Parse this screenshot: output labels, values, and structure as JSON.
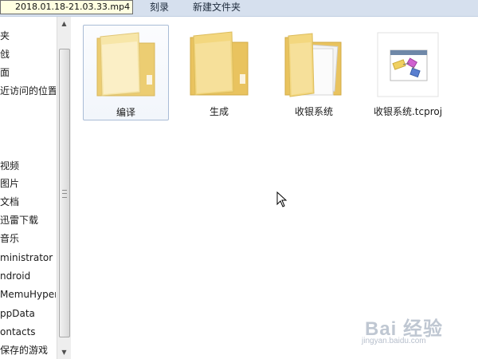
{
  "tooltip": {
    "text": "2018.01.18-21.03.33.mp4"
  },
  "toolbar": {
    "burn_label": "刻录",
    "new_folder_label": "新建文件夹"
  },
  "nav": {
    "items": [
      "夹",
      "戗",
      "面",
      "近访问的位置",
      "视频",
      "图片",
      "文档",
      "迅雷下载",
      "音乐",
      "ministrator",
      "ndroid",
      "MemuHyperv",
      "ppData",
      "ontacts",
      "保存的游戏"
    ]
  },
  "files": [
    {
      "name": "编译",
      "icon": "folder-empty-icon",
      "selected": true
    },
    {
      "name": "生成",
      "icon": "folder-empty-icon",
      "selected": false
    },
    {
      "name": "收银系统",
      "icon": "folder-with-documents-icon",
      "selected": false
    },
    {
      "name": "收银系统.tcproj",
      "icon": "project-file-icon",
      "selected": false
    }
  ],
  "watermark": {
    "brand": "Bai 经验",
    "url": "jingyan.baidu.com"
  },
  "colors": {
    "toolbar_bg": "#d6e0ee",
    "selection_border": "#a9bcd6",
    "folder_yellow": "#f4d77b",
    "folder_light": "#f9eab6"
  }
}
